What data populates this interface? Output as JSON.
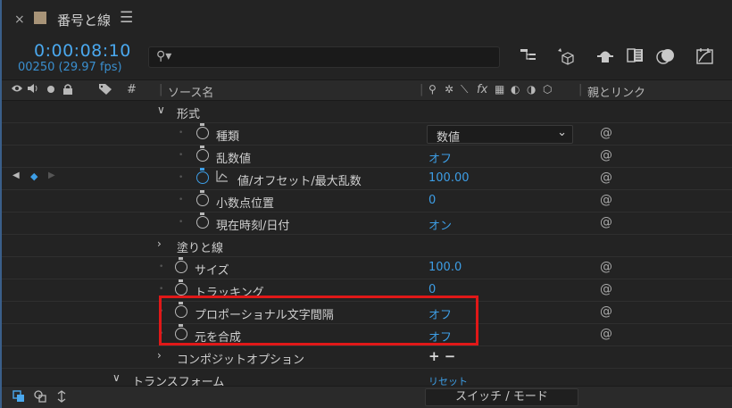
{
  "title_bar": {
    "close": "×",
    "comp_name": "番号と線",
    "menu": "☰"
  },
  "time": {
    "timecode": "0:00:08:10",
    "frames": "00250 (29.97 fps)"
  },
  "search": {
    "icon": "⚲▾"
  },
  "toolbar_icons": [
    "composition-flowchart-icon",
    "draft-3d-icon",
    "shy-icon",
    "frame-blending-icon",
    "motion-blur-icon",
    "graph-editor-icon"
  ],
  "header": {
    "source_name": "ソース名",
    "parent_link": "親とリンク",
    "hash": "#",
    "fx": "fx"
  },
  "rows": [
    {
      "label": "形式",
      "value": ""
    },
    {
      "label": "種類",
      "value": "数値"
    },
    {
      "label": "乱数値",
      "value": "オフ"
    },
    {
      "label": "値/オフセット/最大乱数",
      "value": "100.00"
    },
    {
      "label": "小数点位置",
      "value": "0"
    },
    {
      "label": "現在時刻/日付",
      "value": "オン"
    },
    {
      "label": "塗りと線",
      "value": ""
    },
    {
      "label": "サイズ",
      "value": "100.0"
    },
    {
      "label": "トラッキング",
      "value": "0"
    },
    {
      "label": "プロポーショナル文字間隔",
      "value": "オフ"
    },
    {
      "label": "元を合成",
      "value": "オフ"
    },
    {
      "label": "コンポジットオプション",
      "value": "+ −"
    },
    {
      "label": "トランスフォーム",
      "value": "リセット"
    }
  ],
  "bottom": {
    "switch_mode": "スイッチ / モード"
  },
  "colors": {
    "accent_blue": "#3d9ee6",
    "highlight_red": "#e01818",
    "background": "#232323"
  }
}
